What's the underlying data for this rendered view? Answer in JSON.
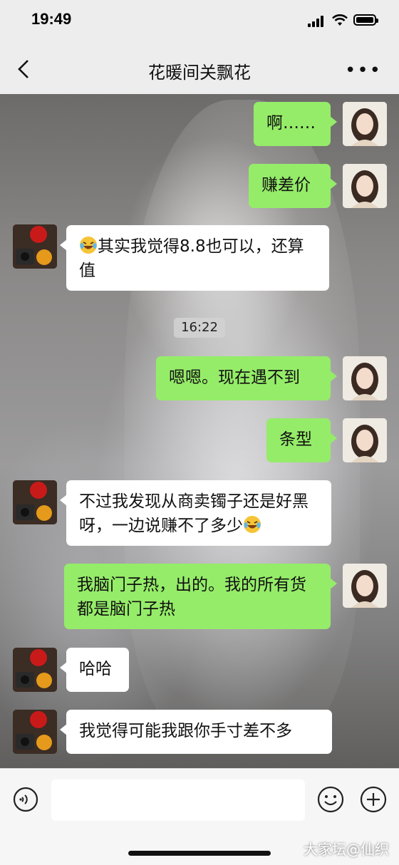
{
  "status_bar": {
    "time": "19:49"
  },
  "nav": {
    "title": "花暖间关飘花",
    "more": "•••"
  },
  "timestamp": "16:22",
  "messages": {
    "m1": "啊……",
    "m2": "赚差价",
    "m3": "其实我觉得8.8也可以，还算值",
    "m4": "嗯嗯。现在遇不到",
    "m5": "条型",
    "m6": "不过我发现从商卖镯子还是好黑呀，一边说赚不了多少",
    "m7": "我脑门子热，出的。我的所有货都是脑门子热",
    "m8": "哈哈",
    "m9": "我觉得可能我跟你手寸差不多"
  },
  "watermark": "大家坛@仙织",
  "colors": {
    "my_bubble": "#95ec69",
    "their_bubble": "#ffffff"
  },
  "icons": [
    "back-chevron-icon",
    "more-dots-icon",
    "voice-icon",
    "emoji-icon",
    "plus-icon",
    "laughing-emoji-icon"
  ]
}
